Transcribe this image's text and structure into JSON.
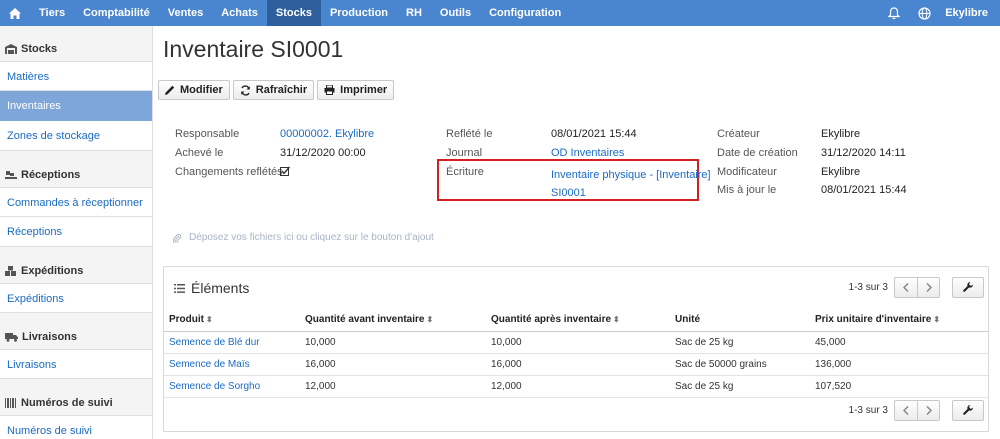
{
  "topnav": {
    "items": [
      "Tiers",
      "Comptabilité",
      "Ventes",
      "Achats",
      "Stocks",
      "Production",
      "RH",
      "Outils",
      "Configuration"
    ],
    "active": "Stocks",
    "user": "Ekylibre"
  },
  "sidebar": {
    "sections": [
      {
        "title": "Stocks",
        "items": [
          "Matières",
          "Inventaires",
          "Zones de stockage"
        ]
      },
      {
        "title": "Réceptions",
        "items": [
          "Commandes à réceptionner",
          "Réceptions"
        ]
      },
      {
        "title": "Expéditions",
        "items": [
          "Expéditions"
        ]
      },
      {
        "title": "Livraisons",
        "items": [
          "Livraisons"
        ]
      },
      {
        "title": "Numéros de suivi",
        "items": [
          "Numéros de suivi"
        ]
      }
    ],
    "active_item": "Inventaires"
  },
  "page": {
    "title": "Inventaire SI0001",
    "toolbar": {
      "edit": "Modifier",
      "refresh": "Rafraîchir",
      "print": "Imprimer"
    }
  },
  "fields": {
    "responsable_label": "Responsable",
    "responsable_value": "00000002. Ekylibre",
    "acheve_label": "Achevé le",
    "acheve_value": "31/12/2020 00:00",
    "changements_label": "Changements reflétés",
    "reflete_label": "Reflété le",
    "reflete_value": "08/01/2021 15:44",
    "journal_label": "Journal",
    "journal_value": "OD Inventaires",
    "ecriture_label": "Écriture",
    "ecriture_value_line1": "Inventaire physique - [Inventaire]",
    "ecriture_value_line2": "SI0001",
    "createur_label": "Créateur",
    "createur_value": "Ekylibre",
    "date_creation_label": "Date de création",
    "date_creation_value": "31/12/2020 14:11",
    "modificateur_label": "Modificateur",
    "modificateur_value": "Ekylibre",
    "maj_label": "Mis à jour le",
    "maj_value": "08/01/2021 15:44"
  },
  "dropzone": "Déposez vos fichiers ici ou cliquez sur le bouton d'ajout",
  "elements": {
    "title": "Éléments",
    "pager_text": "1-3 sur 3",
    "columns": [
      "Produit",
      "Quantité avant inventaire",
      "Quantité après inventaire",
      "Unité",
      "Prix unitaire d'inventaire"
    ],
    "rows": [
      [
        "Semence de Blé dur",
        "10,000",
        "10,000",
        "Sac de 25 kg",
        "45,000"
      ],
      [
        "Semence de Maïs",
        "16,000",
        "16,000",
        "Sac de 50000 grains",
        "136,000"
      ],
      [
        "Semence de Sorgho",
        "12,000",
        "12,000",
        "Sac de 25 kg",
        "107,520"
      ]
    ]
  },
  "colors": {
    "nav": "#4a86cf",
    "nav_active": "#2d5f9c",
    "link": "#1a6bc4",
    "sidebar_active": "#7ea6d9",
    "highlight": "#d42020"
  }
}
